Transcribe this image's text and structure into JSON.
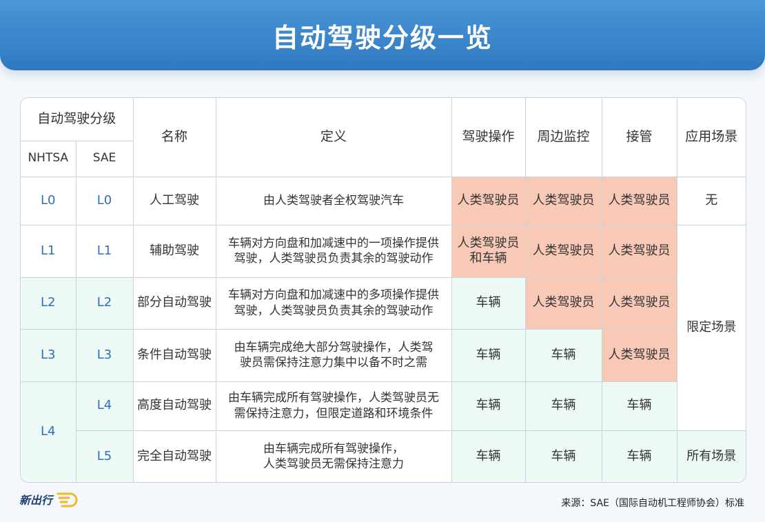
{
  "title": "自动驾驶分级一览",
  "table": {
    "headers": {
      "level_group": "自动驾驶分级",
      "nhtsa": "NHTSA",
      "sae": "SAE",
      "name": "名称",
      "definition": "定义",
      "drive": "驾驶操作",
      "monitor": "周边监控",
      "takeover": "接管",
      "scenario": "应用场景"
    },
    "rows": [
      {
        "nhtsa": "L0",
        "sae": "L0",
        "name": "人工驾驶",
        "def1": "由人类驾驶者全权驾驶汽车",
        "def2": "",
        "drive1": "人类驾驶员",
        "drive2": "",
        "monitor": "人类驾驶员",
        "takeover": "人类驾驶员",
        "scenario": "无"
      },
      {
        "nhtsa": "L1",
        "sae": "L1",
        "name": "辅助驾驶",
        "def1": "车辆对方向盘和加减速中的一项操作提供",
        "def2": "驾驶，人类驾驶员负责其余的驾驶动作",
        "drive1": "人类驾驶员",
        "drive2": "和车辆",
        "monitor": "人类驾驶员",
        "takeover": "人类驾驶员",
        "scenario": "限定场景"
      },
      {
        "nhtsa": "L2",
        "sae": "L2",
        "name": "部分自动驾驶",
        "def1": "车辆对方向盘和加减速中的多项操作提供",
        "def2": "驾驶，人类驾驶员负责其余的驾驶动作",
        "drive1": "车辆",
        "drive2": "",
        "monitor": "人类驾驶员",
        "takeover": "人类驾驶员",
        "scenario": ""
      },
      {
        "nhtsa": "L3",
        "sae": "L3",
        "name": "条件自动驾驶",
        "def1": "由车辆完成绝大部分驾驶操作，人类驾",
        "def2": "驶员需保持注意力集中以备不时之需",
        "drive1": "车辆",
        "drive2": "",
        "monitor": "车辆",
        "takeover": "人类驾驶员",
        "scenario": ""
      },
      {
        "nhtsa": "L4",
        "sae": "L4",
        "name": "高度自动驾驶",
        "def1": "由车辆完成所有驾驶操作，人类驾驶员无",
        "def2": "需保持注意力，但限定道路和环境条件",
        "drive1": "车辆",
        "drive2": "",
        "monitor": "车辆",
        "takeover": "车辆",
        "scenario": ""
      },
      {
        "nhtsa": "",
        "sae": "L5",
        "name": "完全自动驾驶",
        "def1": "由车辆完成所有驾驶操作，",
        "def2": "人类驾驶员无需保持注意力",
        "drive1": "车辆",
        "drive2": "",
        "monitor": "车辆",
        "takeover": "车辆",
        "scenario": "所有场景"
      }
    ]
  },
  "footer": {
    "logo": "新出行",
    "source": "来源：SAE（国际自动机工程师协会）标准"
  },
  "colors": {
    "header_bg": "#3a86cc",
    "human_cell": "#f9c9b8",
    "vehicle_cell": "#edf9f5",
    "level_text": "#2e6fb7",
    "border": "#c9d3dc"
  }
}
